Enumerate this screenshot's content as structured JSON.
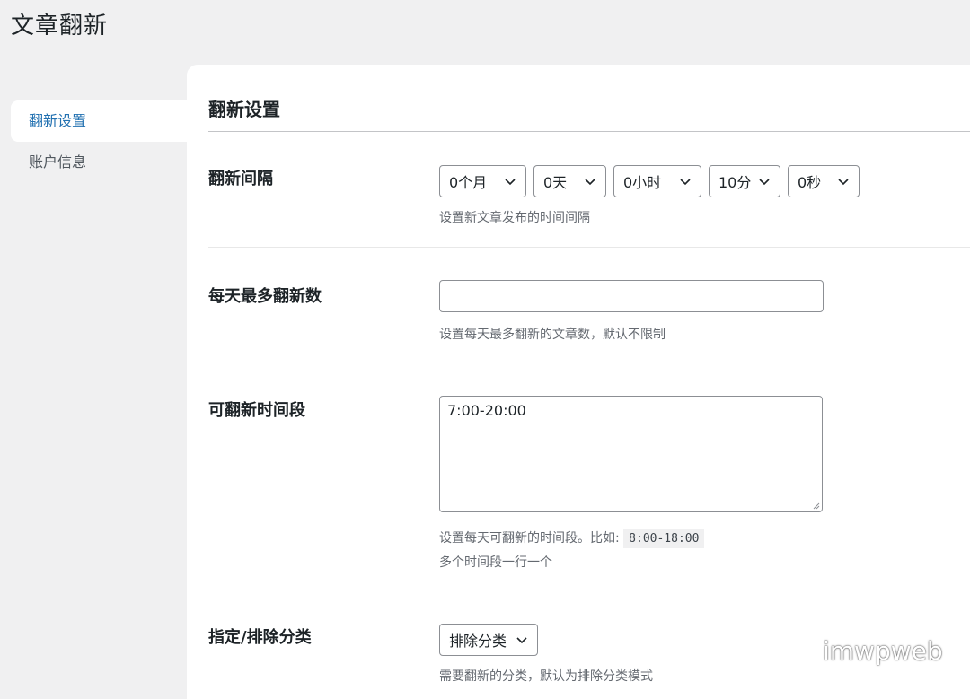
{
  "page": {
    "title": "文章翻新"
  },
  "sidebar": {
    "items": [
      {
        "label": "翻新设置",
        "active": true
      },
      {
        "label": "账户信息",
        "active": false
      }
    ]
  },
  "section": {
    "title": "翻新设置"
  },
  "interval": {
    "label": "翻新间隔",
    "selects": [
      "0个月",
      "0天",
      "0小时",
      "10分",
      "0秒"
    ],
    "help": "设置新文章发布的时间间隔"
  },
  "daily_max": {
    "label": "每天最多翻新数",
    "value": "",
    "help": "设置每天最多翻新的文章数，默认不限制"
  },
  "time_range": {
    "label": "可翻新时间段",
    "value": "7:00-20:00",
    "help_prefix": "设置每天可翻新的时间段。比如:",
    "help_code": "8:00-18:00",
    "help_line2": "多个时间段一行一个"
  },
  "category": {
    "label": "指定/排除分类",
    "select": "排除分类",
    "help": "需要翻新的分类，默认为排除分类模式"
  },
  "watermark": {
    "text": "imwpweb",
    "icon": "wechat-icon"
  },
  "colors": {
    "accent": "#2271b1",
    "background": "#f0f0f1",
    "panel": "#ffffff"
  }
}
